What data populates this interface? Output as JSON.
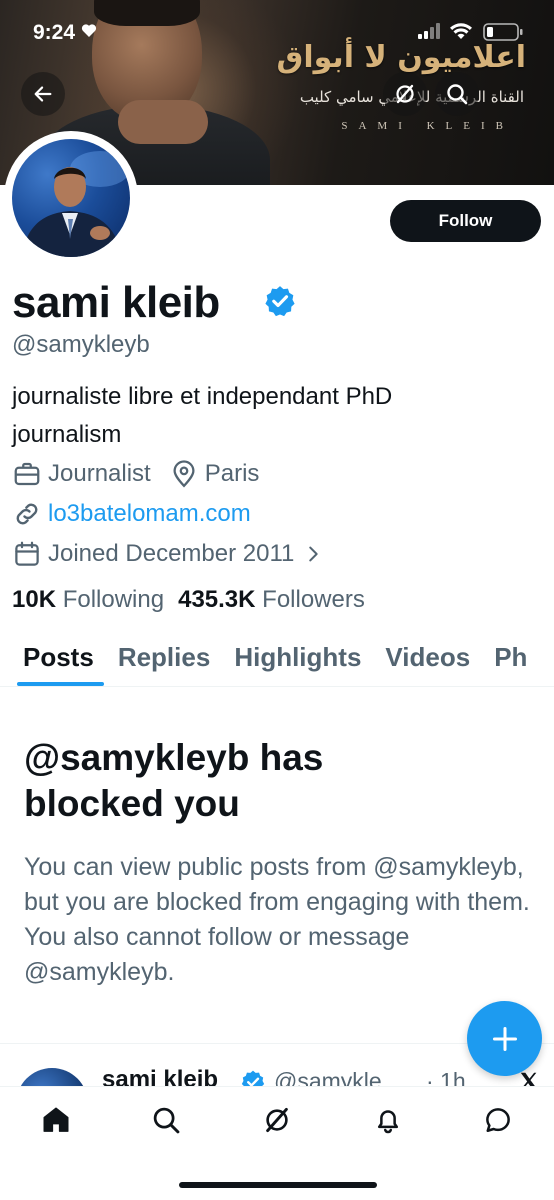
{
  "status_bar": {
    "time": "9:24"
  },
  "banner": {
    "title_ar": "اعلاميون لا أبواق",
    "subtitle_ar": "القناة الرسمية للإعلامي سامي كليب",
    "signature": "SAMI KLEIB"
  },
  "header": {
    "back_icon": "arrow-left-icon",
    "grok_icon": "grok-icon",
    "search_icon": "search-icon"
  },
  "profile": {
    "follow_label": "Follow",
    "display_name": "sami kleib",
    "verified_color": "#1d9bf0",
    "handle": "@samykleyb",
    "bio_line1": "journaliste libre et independant PhD",
    "bio_line2": "journalism",
    "profession": "Journalist",
    "location": "Paris",
    "website": "lo3batelomam.com",
    "joined": "Joined December 2011",
    "following_count": "10K",
    "following_label": "Following",
    "followers_count": "435.3K",
    "followers_label": "Followers"
  },
  "tabs": [
    {
      "label": "Posts",
      "active": true
    },
    {
      "label": "Replies",
      "active": false
    },
    {
      "label": "Highlights",
      "active": false
    },
    {
      "label": "Videos",
      "active": false
    },
    {
      "label": "Ph",
      "active": false
    }
  ],
  "blocked": {
    "title_line1": "@samykleyb has",
    "title_line2": "blocked you",
    "description": "You can view public posts from @samykleyb, but you are blocked from engaging with them. You also cannot follow or message @samykleyb."
  },
  "post_preview": {
    "name": "sami kleib",
    "handle": "@samykle...",
    "time": "· 1h"
  },
  "fab": {
    "icon": "plus-icon"
  },
  "bottom_nav": [
    {
      "icon": "home-icon",
      "active": true
    },
    {
      "icon": "search-icon",
      "active": false
    },
    {
      "icon": "grok-icon",
      "active": false
    },
    {
      "icon": "bell-icon",
      "active": false
    },
    {
      "icon": "messages-icon",
      "active": false
    }
  ],
  "colors": {
    "accent": "#1d9bf0",
    "text": "#0f1419",
    "secondary": "#536471"
  }
}
